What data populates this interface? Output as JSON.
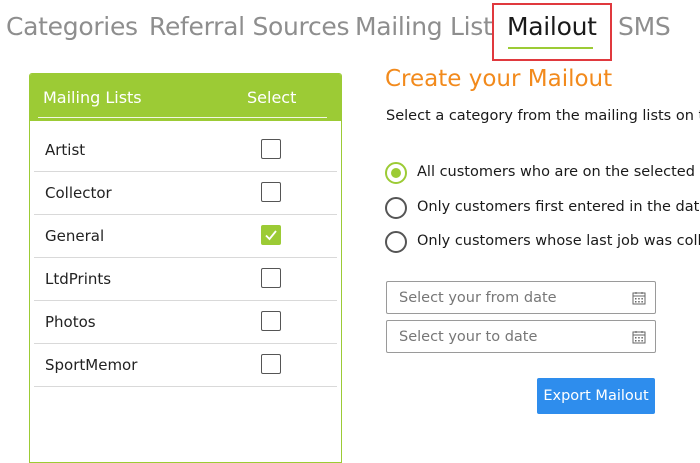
{
  "tabs": [
    {
      "label": "Categories"
    },
    {
      "label": "Referral Sources"
    },
    {
      "label": "Mailing List"
    },
    {
      "label": "Mailout",
      "active": true
    },
    {
      "label": "SMS"
    }
  ],
  "mailing_panel": {
    "header_label": "Mailing Lists",
    "select_label": "Select",
    "accent_color": "#9ccb35",
    "rows": [
      {
        "name": "Artist",
        "checked": false
      },
      {
        "name": "Collector",
        "checked": false
      },
      {
        "name": "General",
        "checked": true
      },
      {
        "name": "LtdPrints",
        "checked": false
      },
      {
        "name": "Photos",
        "checked": false
      },
      {
        "name": "SportMemor",
        "checked": false
      }
    ]
  },
  "mailout": {
    "title": "Create your Mailout",
    "title_color": "#f28a1c",
    "instructions": "Select a category from the mailing lists on the l",
    "options": [
      {
        "label": "All customers who are on the selected list",
        "selected": true
      },
      {
        "label": "Only customers first entered in the date ra",
        "selected": false
      },
      {
        "label": "Only customers whose last job was collecte",
        "selected": false
      }
    ],
    "from_date_placeholder": "Select your from date",
    "to_date_placeholder": "Select your to date",
    "calendar_icon": "calendar-icon",
    "export_label": "Export Mailout",
    "export_color": "#2e8ded"
  }
}
